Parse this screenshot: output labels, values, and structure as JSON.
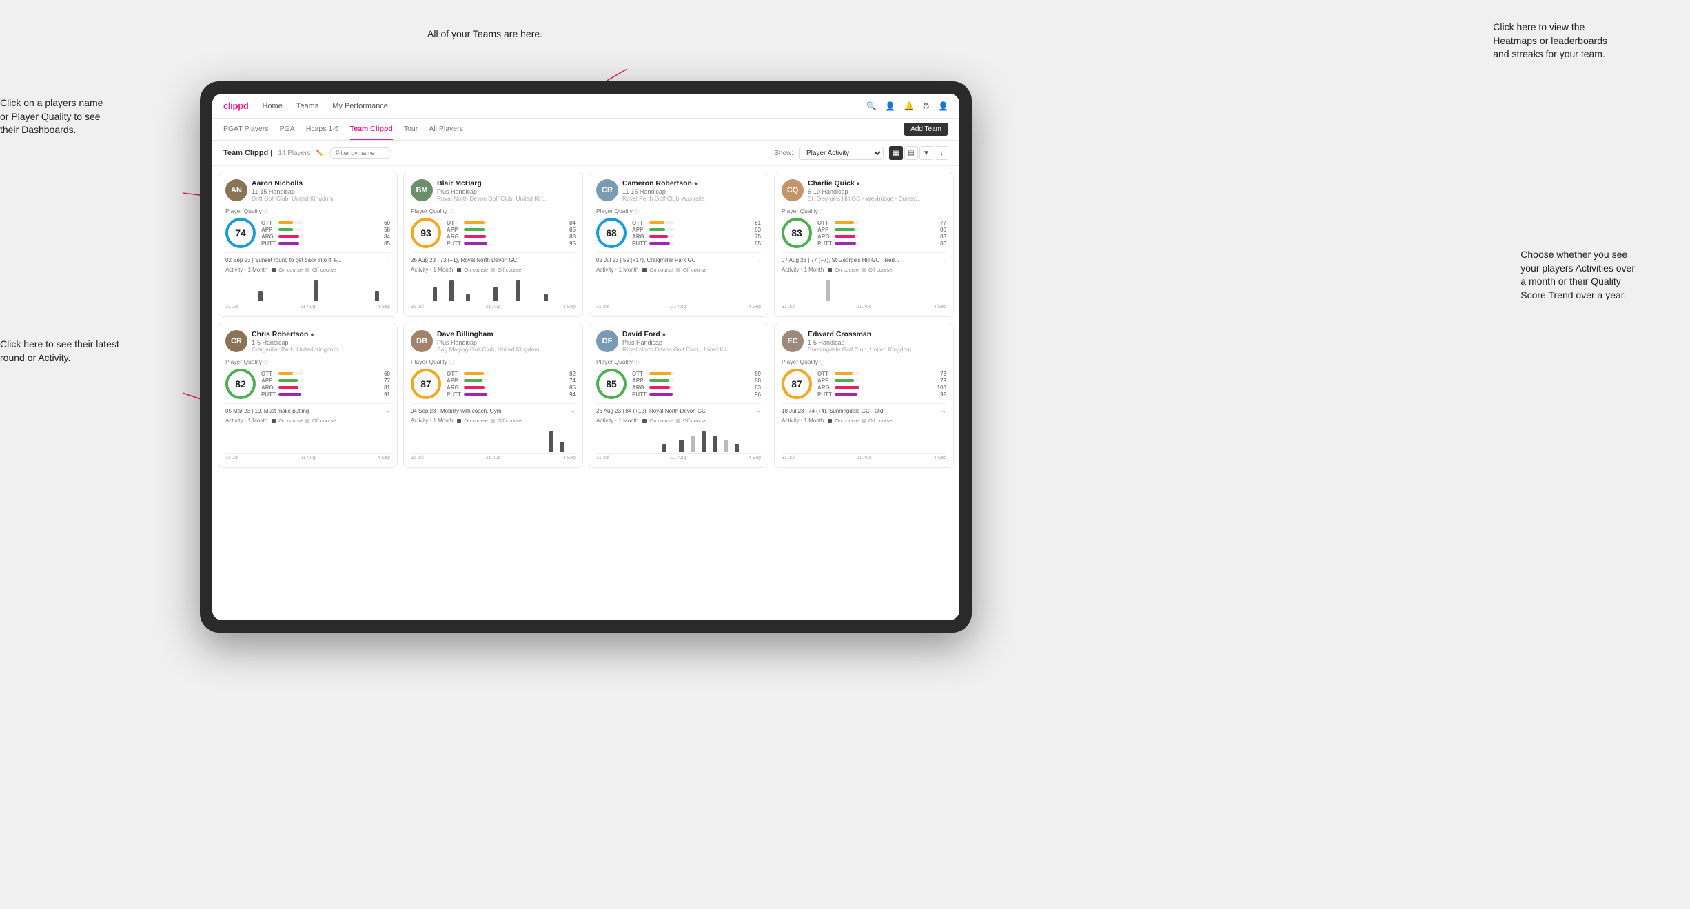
{
  "annotations": {
    "teams": "All of your Teams are here.",
    "heatmaps": "Click here to view the\nHeatmaps or leaderboards\nand streaks for your team.",
    "player_name": "Click on a players name\nor Player Quality to see\ntheir Dashboards.",
    "latest_round": "Click here to see their latest\nround or Activity.",
    "activities": "Choose whether you see\nyour players Activities over\na month or their Quality\nScore Trend over a year."
  },
  "nav": {
    "logo": "clippd",
    "items": [
      "Home",
      "Teams",
      "My Performance"
    ],
    "icons": [
      "🔍",
      "👤",
      "🔔",
      "⚙",
      "👤"
    ]
  },
  "tabs": {
    "items": [
      "PGAT Players",
      "PGA",
      "Hcaps 1-5",
      "Team Clippd",
      "Tour",
      "All Players"
    ],
    "active": "Team Clippd",
    "add_team": "Add Team"
  },
  "team_header": {
    "title": "Team Clippd",
    "count": "14 Players",
    "show_label": "Show:",
    "show_value": "Player Activity",
    "filter_placeholder": "Filter by name"
  },
  "players": [
    {
      "name": "Aaron Nicholls",
      "handicap": "11-15 Handicap",
      "club": "Drift Golf Club, United Kingdom",
      "quality": 74,
      "quality_color": "blue",
      "avatar_color": "#8B7355",
      "initials": "AN",
      "ott": 60,
      "app": 58,
      "arg": 84,
      "putt": 85,
      "last_round": "02 Sep 23 | Sunset round to get back into it, F...",
      "chart_data": [
        0,
        0,
        0,
        0,
        0,
        0,
        1,
        0,
        0,
        0,
        0,
        0,
        0,
        0,
        0,
        0,
        2,
        0,
        0,
        0,
        0,
        0,
        0,
        0,
        0,
        0,
        0,
        1,
        0,
        0
      ],
      "chart_labels": [
        "31 Jul",
        "21 Aug",
        "4 Sep"
      ]
    },
    {
      "name": "Blair McHarg",
      "handicap": "Plus Handicap",
      "club": "Royal North Devon Golf Club, United Kin...",
      "quality": 93,
      "quality_color": "gold",
      "avatar_color": "#6B8E6B",
      "initials": "BM",
      "ott": 84,
      "app": 85,
      "arg": 88,
      "putt": 95,
      "last_round": "26 Aug 23 | 73 (+1), Royal North Devon GC",
      "chart_data": [
        0,
        0,
        0,
        0,
        2,
        0,
        0,
        3,
        0,
        0,
        1,
        0,
        0,
        0,
        0,
        2,
        0,
        0,
        0,
        3,
        0,
        0,
        0,
        0,
        1,
        0,
        0,
        0,
        0,
        0
      ],
      "chart_labels": [
        "31 Jul",
        "21 Aug",
        "4 Sep"
      ]
    },
    {
      "name": "Cameron Robertson",
      "handicap": "11-15 Handicap",
      "club": "Royal Perth Golf Club, Australia",
      "quality": 68,
      "quality_color": "blue",
      "avatar_color": "#7B9BB5",
      "initials": "CR",
      "ott": 61,
      "app": 63,
      "arg": 75,
      "putt": 85,
      "last_round": "02 Jul 23 | 59 (+17), Craigmillar Park GC",
      "chart_data": [
        0,
        0,
        0,
        0,
        0,
        0,
        0,
        0,
        0,
        0,
        0,
        0,
        0,
        0,
        0,
        0,
        0,
        0,
        0,
        0,
        0,
        0,
        0,
        0,
        0,
        0,
        0,
        0,
        0,
        0
      ],
      "chart_labels": [
        "31 Jul",
        "21 Aug",
        "4 Sep"
      ]
    },
    {
      "name": "Charlie Quick",
      "handicap": "6-10 Handicap",
      "club": "St. George's Hill GC - Weybridge - Surrey...",
      "quality": 83,
      "quality_color": "green",
      "avatar_color": "#C4956A",
      "initials": "CQ",
      "ott": 77,
      "app": 80,
      "arg": 83,
      "putt": 86,
      "last_round": "07 Aug 23 | 77 (+7), St George's Hill GC - Red...",
      "chart_data": [
        0,
        0,
        0,
        0,
        0,
        0,
        0,
        0,
        1,
        0,
        0,
        0,
        0,
        0,
        0,
        0,
        0,
        0,
        0,
        0,
        0,
        0,
        0,
        0,
        0,
        0,
        0,
        0,
        0,
        0
      ],
      "chart_labels": [
        "31 Jul",
        "21 Aug",
        "4 Sep"
      ]
    },
    {
      "name": "Chris Robertson",
      "handicap": "1-5 Handicap",
      "club": "Craigmillar Park, United Kingdom",
      "quality": 82,
      "quality_color": "green",
      "avatar_color": "#8B7355",
      "initials": "CR",
      "ott": 60,
      "app": 77,
      "arg": 81,
      "putt": 91,
      "last_round": "05 Mar 23 | 19, Must make putting",
      "chart_data": [
        0,
        0,
        0,
        0,
        0,
        0,
        0,
        0,
        0,
        0,
        0,
        0,
        0,
        0,
        0,
        0,
        0,
        0,
        0,
        0,
        0,
        0,
        0,
        0,
        0,
        0,
        0,
        0,
        0,
        0
      ],
      "chart_labels": [
        "31 Jul",
        "21 Aug",
        "4 Sep"
      ]
    },
    {
      "name": "Dave Billingham",
      "handicap": "Plus Handicap",
      "club": "Sag Maging Golf Club, United Kingdom",
      "quality": 87,
      "quality_color": "gold",
      "avatar_color": "#A0836A",
      "initials": "DB",
      "ott": 82,
      "app": 74,
      "arg": 85,
      "putt": 94,
      "last_round": "04 Sep 23 | Mobility with coach, Gym",
      "chart_data": [
        0,
        0,
        0,
        0,
        0,
        0,
        0,
        0,
        0,
        0,
        0,
        0,
        0,
        0,
        0,
        0,
        0,
        0,
        0,
        0,
        0,
        0,
        0,
        0,
        0,
        2,
        0,
        1,
        0,
        0
      ],
      "chart_labels": [
        "31 Jul",
        "21 Aug",
        "4 Sep"
      ]
    },
    {
      "name": "David Ford",
      "handicap": "Plus Handicap",
      "club": "Royal North Devon Golf Club, United Kii...",
      "quality": 85,
      "quality_color": "green",
      "avatar_color": "#7B9BB5",
      "initials": "DF",
      "ott": 89,
      "app": 80,
      "arg": 83,
      "putt": 96,
      "last_round": "26 Aug 23 | 84 (+12), Royal North Devon GC",
      "chart_data": [
        0,
        0,
        0,
        0,
        0,
        0,
        0,
        0,
        0,
        0,
        0,
        0,
        2,
        0,
        0,
        3,
        0,
        4,
        0,
        5,
        0,
        4,
        0,
        3,
        0,
        2,
        0,
        0,
        0,
        0
      ],
      "chart_labels": [
        "31 Jul",
        "21 Aug",
        "4 Sep"
      ]
    },
    {
      "name": "Edward Crossman",
      "handicap": "1-5 Handicap",
      "club": "Sunningdale Golf Club, United Kingdom",
      "quality": 87,
      "quality_color": "gold",
      "avatar_color": "#9B8B7A",
      "initials": "EC",
      "ott": 73,
      "app": 79,
      "arg": 103,
      "putt": 92,
      "last_round": "18 Jul 23 | 74 (+4), Sunningdale GC - Old",
      "chart_data": [
        0,
        0,
        0,
        0,
        0,
        0,
        0,
        0,
        0,
        0,
        0,
        0,
        0,
        0,
        0,
        0,
        0,
        0,
        0,
        0,
        0,
        0,
        0,
        0,
        0,
        0,
        0,
        0,
        0,
        0
      ],
      "chart_labels": [
        "31 Jul",
        "21 Aug",
        "4 Sep"
      ]
    }
  ]
}
